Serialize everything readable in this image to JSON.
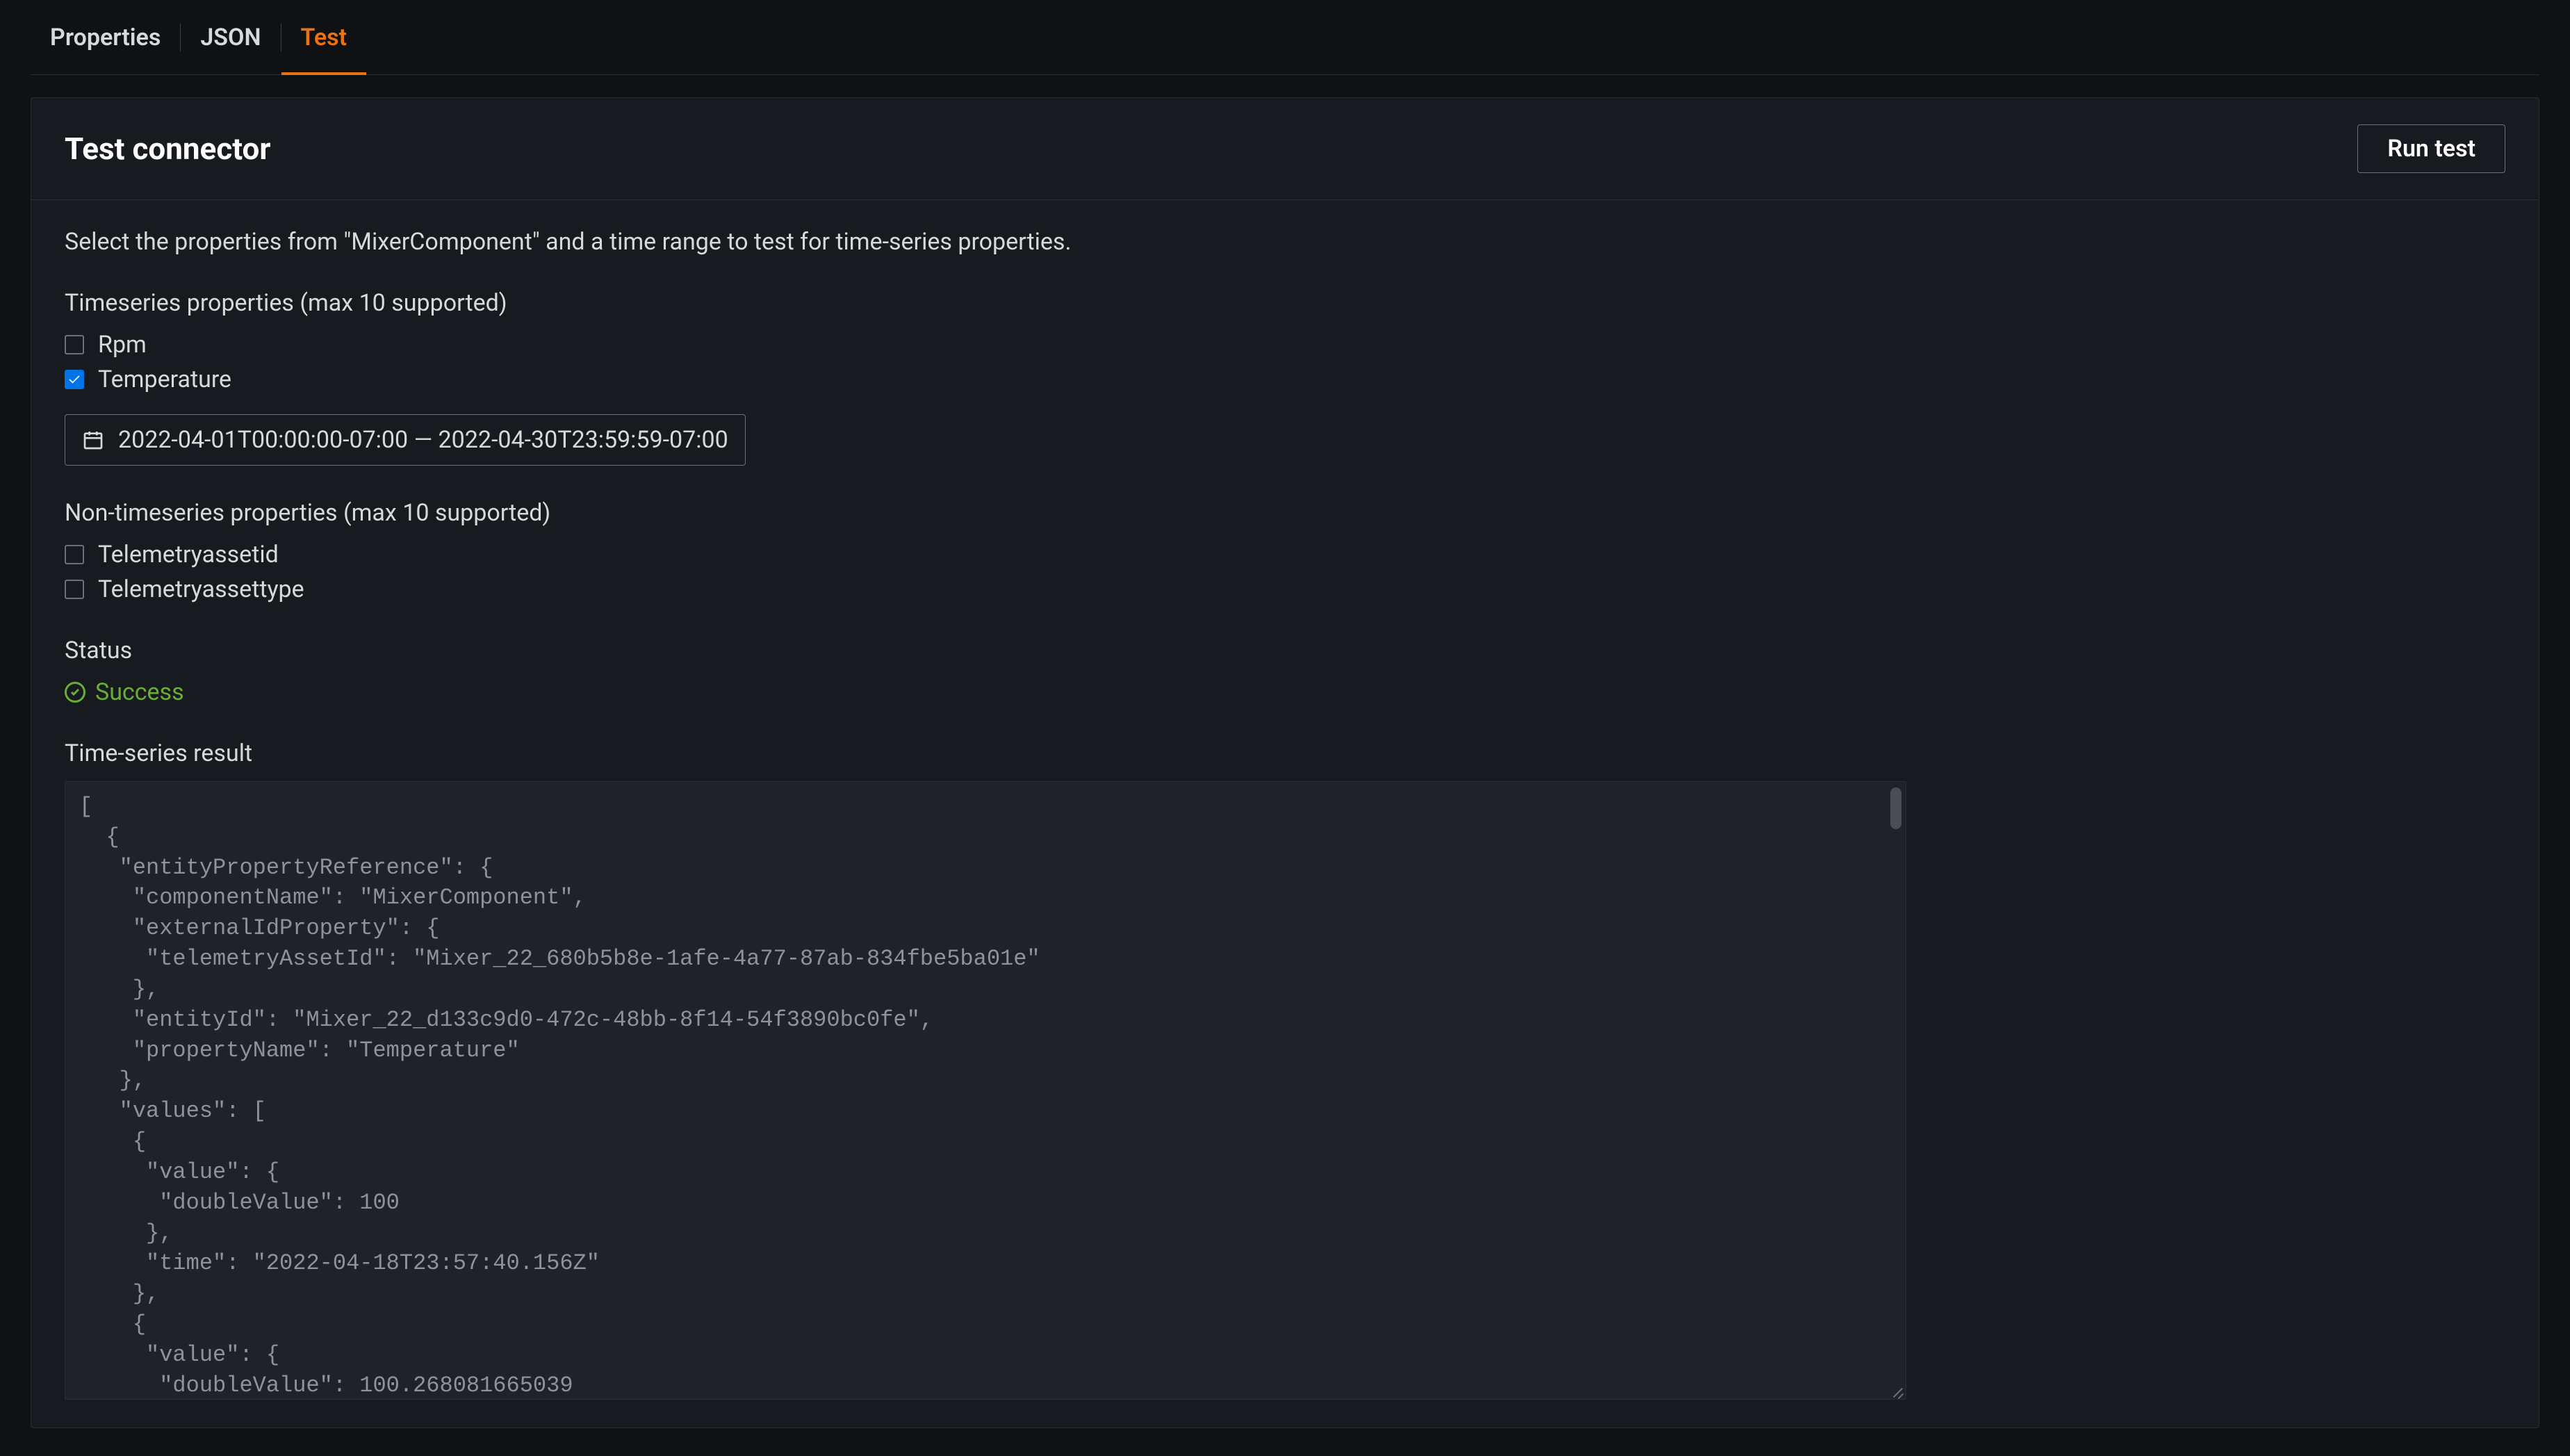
{
  "tabs": {
    "properties": "Properties",
    "json": "JSON",
    "test": "Test",
    "active": "test"
  },
  "panel": {
    "title": "Test connector",
    "run_test": "Run test",
    "desc": "Select the properties from \"MixerComponent\" and a time range to test for time-series properties."
  },
  "ts": {
    "label": "Timeseries properties (max 10 supported)",
    "items": [
      {
        "label": "Rpm",
        "checked": false
      },
      {
        "label": "Temperature",
        "checked": true
      }
    ]
  },
  "date_range": "2022-04-01T00:00:00-07:00 — 2022-04-30T23:59:59-07:00",
  "nts": {
    "label": "Non-timeseries properties (max 10 supported)",
    "items": [
      {
        "label": "Telemetryassetid",
        "checked": false
      },
      {
        "label": "Telemetryassettype",
        "checked": false
      }
    ]
  },
  "status": {
    "label": "Status",
    "value": "Success"
  },
  "result": {
    "label": "Time-series result",
    "text": "[\n  {\n   \"entityPropertyReference\": {\n    \"componentName\": \"MixerComponent\",\n    \"externalIdProperty\": {\n     \"telemetryAssetId\": \"Mixer_22_680b5b8e-1afe-4a77-87ab-834fbe5ba01e\"\n    },\n    \"entityId\": \"Mixer_22_d133c9d0-472c-48bb-8f14-54f3890bc0fe\",\n    \"propertyName\": \"Temperature\"\n   },\n   \"values\": [\n    {\n     \"value\": {\n      \"doubleValue\": 100\n     },\n     \"time\": \"2022-04-18T23:57:40.156Z\"\n    },\n    {\n     \"value\": {\n      \"doubleValue\": 100.268081665039"
  }
}
